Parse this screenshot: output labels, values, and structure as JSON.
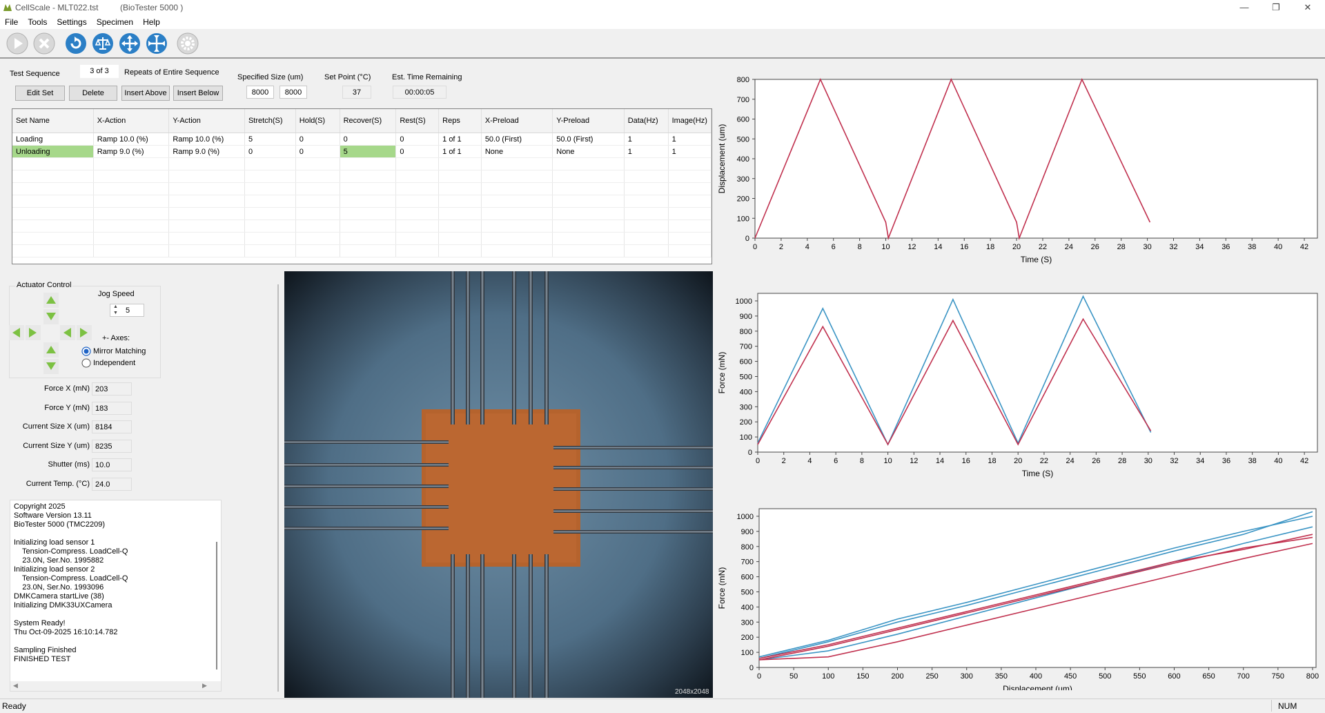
{
  "window": {
    "app_name": "CellScale - MLT022.tst",
    "device": "(BioTester 5000 )",
    "minimize": "—",
    "restore": "❐",
    "close": "✕"
  },
  "menu": [
    "File",
    "Tools",
    "Settings",
    "Specimen",
    "Help"
  ],
  "toolbar_icons": [
    "play-icon",
    "stop-icon",
    "refresh-icon",
    "balance-icon",
    "expand-icon",
    "fit-icon",
    "gear-icon"
  ],
  "sequence": {
    "label": "Test Sequence",
    "repeats_value": "3 of 3",
    "repeats_label": "Repeats of Entire Sequence",
    "specified_size_label": "Specified Size (um)",
    "size_x": "8000",
    "size_y": "8000",
    "set_point_label": "Set Point (°C)",
    "set_point": "37",
    "est_time_label": "Est. Time Remaining",
    "est_time": "00:00:05",
    "buttons": {
      "edit": "Edit Set",
      "delete": "Delete",
      "insert_above": "Insert Above",
      "insert_below": "Insert Below"
    }
  },
  "table": {
    "columns": [
      "Set Name",
      "X-Action",
      "Y-Action",
      "Stretch(S)",
      "Hold(S)",
      "Recover(S)",
      "Rest(S)",
      "Reps",
      "X-Preload",
      "Y-Preload",
      "Data(Hz)",
      "Image(Hz)"
    ],
    "rows": [
      [
        "Loading",
        "Ramp 10.0 (%)",
        "Ramp 10.0 (%)",
        "5",
        "0",
        "0",
        "0",
        "1 of 1",
        "50.0 (First)",
        "50.0 (First)",
        "1",
        "1"
      ],
      [
        "Unloading",
        "Ramp 9.0 (%)",
        "Ramp 9.0 (%)",
        "0",
        "0",
        "5",
        "0",
        "1 of 1",
        "None",
        "None",
        "1",
        "1"
      ]
    ]
  },
  "actuator": {
    "title": "Actuator Control",
    "jog_label": "Jog Speed",
    "jog_value": "5",
    "axes_label": "+- Axes:",
    "mirror": "Mirror Matching",
    "independent": "Independent"
  },
  "readouts": [
    {
      "label": "Force X (mN)",
      "value": "203"
    },
    {
      "label": "Force Y (mN)",
      "value": "183"
    },
    {
      "label": "Current Size X (um)",
      "value": "8184"
    },
    {
      "label": "Current Size Y (um)",
      "value": "8235"
    },
    {
      "label": "Shutter (ms)",
      "value": "10.0"
    },
    {
      "label": "Current Temp. (°C)",
      "value": "24.0"
    }
  ],
  "console": "Copyright 2025\nSoftware Version 13.11\nBioTester 5000 (TMC2209)\n\nInitializing load sensor 1\n    Tension-Compress. LoadCell-Q\n    23.0N, Ser.No. 1995882\nInitializing load sensor 2\n    Tension-Compress. LoadCell-Q\n    23.0N, Ser.No. 1993096\nDMKCamera startLive (38)\nInitializing DMK33UXCamera\n\nSystem Ready!\nThu Oct-09-2025 16:10:14.782\n\nSampling Finished\nFINISHED TEST",
  "camera": {
    "resolution": "2048x2048"
  },
  "status": {
    "left": "Ready",
    "right": "NUM"
  },
  "colors": {
    "red": "#c0304e",
    "blue": "#3a94c4"
  },
  "chart_data": [
    {
      "type": "line",
      "xlabel": "Time (S)",
      "ylabel": "Displacement (um)",
      "xlim": [
        0,
        43
      ],
      "ylim": [
        0,
        800
      ],
      "xticks": [
        0,
        2,
        4,
        6,
        8,
        10,
        12,
        14,
        16,
        18,
        20,
        22,
        24,
        26,
        28,
        30,
        32,
        34,
        36,
        38,
        40,
        42
      ],
      "yticks": [
        0,
        100,
        200,
        300,
        400,
        500,
        600,
        700,
        800
      ],
      "series": [
        {
          "color": "#c0304e",
          "x": [
            0,
            5,
            10,
            10.2,
            15,
            20,
            20.2,
            25,
            30.2
          ],
          "y": [
            0,
            800,
            80,
            0,
            800,
            80,
            0,
            800,
            80
          ]
        }
      ]
    },
    {
      "type": "line",
      "xlabel": "Time (S)",
      "ylabel": "Force (mN)",
      "xlim": [
        0,
        43
      ],
      "ylim": [
        0,
        1050
      ],
      "xticks": [
        0,
        2,
        4,
        6,
        8,
        10,
        12,
        14,
        16,
        18,
        20,
        22,
        24,
        26,
        28,
        30,
        32,
        34,
        36,
        38,
        40,
        42
      ],
      "yticks": [
        0,
        100,
        200,
        300,
        400,
        500,
        600,
        700,
        800,
        900,
        1000
      ],
      "series": [
        {
          "color": "#3a94c4",
          "x": [
            0,
            5,
            10,
            15,
            20,
            25,
            30.2
          ],
          "y": [
            60,
            950,
            50,
            1010,
            60,
            1030,
            130
          ]
        },
        {
          "color": "#c0304e",
          "x": [
            0,
            5,
            10,
            15,
            20,
            25,
            30.2
          ],
          "y": [
            50,
            830,
            50,
            870,
            50,
            880,
            140
          ]
        }
      ]
    },
    {
      "type": "line",
      "xlabel": "Displacement (um)",
      "ylabel": "Force (mN)",
      "xlim": [
        0,
        805
      ],
      "ylim": [
        0,
        1050
      ],
      "xticks": [
        0,
        50,
        100,
        150,
        200,
        250,
        300,
        350,
        400,
        450,
        500,
        550,
        600,
        650,
        700,
        750,
        800
      ],
      "yticks": [
        0,
        100,
        200,
        300,
        400,
        500,
        600,
        700,
        800,
        900,
        1000
      ],
      "series": [
        {
          "color": "#3a94c4",
          "x": [
            0,
            100,
            200,
            300,
            400,
            500,
            600,
            700,
            800
          ],
          "y": [
            60,
            170,
            300,
            410,
            530,
            650,
            770,
            880,
            1030
          ]
        },
        {
          "color": "#3a94c4",
          "x": [
            800,
            700,
            600,
            500,
            400,
            300,
            200,
            100,
            0
          ],
          "y": [
            930,
            820,
            700,
            580,
            460,
            340,
            220,
            110,
            50
          ]
        },
        {
          "color": "#3a94c4",
          "x": [
            0,
            100,
            200,
            300,
            400,
            500,
            600,
            700,
            800
          ],
          "y": [
            70,
            180,
            320,
            430,
            550,
            670,
            790,
            900,
            1000
          ]
        },
        {
          "color": "#c0304e",
          "x": [
            0,
            100,
            200,
            300,
            400,
            500,
            600,
            700,
            800
          ],
          "y": [
            60,
            150,
            260,
            370,
            480,
            590,
            700,
            780,
            880
          ]
        },
        {
          "color": "#c0304e",
          "x": [
            800,
            700,
            600,
            500,
            400,
            300,
            200,
            100,
            0
          ],
          "y": [
            820,
            720,
            610,
            500,
            390,
            280,
            170,
            70,
            50
          ]
        },
        {
          "color": "#c0304e",
          "x": [
            0,
            100,
            200,
            300,
            400,
            500,
            600,
            700,
            800
          ],
          "y": [
            50,
            140,
            250,
            360,
            470,
            580,
            690,
            790,
            860
          ]
        }
      ]
    }
  ]
}
